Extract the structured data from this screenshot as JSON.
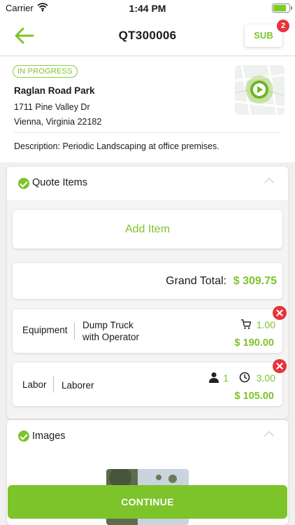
{
  "statusbar": {
    "carrier": "Carrier",
    "time": "1:44 PM"
  },
  "header": {
    "title": "QT300006",
    "sub_label": "SUB",
    "sub_badge": "2"
  },
  "details": {
    "status": "IN PROGRESS",
    "park": "Raglan Road Park",
    "address1": "1711 Pine Valley Dr",
    "address2": "Vienna, Virginia 22182",
    "description": "Description: Periodic Landscaping at office premises."
  },
  "quote_items": {
    "title": "Quote Items",
    "add_item": "Add Item",
    "grand_total_label": "Grand Total:",
    "grand_total_value": "$ 309.75",
    "items": [
      {
        "type": "Equipment",
        "name_line1": "Dump Truck",
        "name_line2": "with Operator",
        "quantity": "1.00",
        "price": "$ 190.00"
      },
      {
        "type": "Labor",
        "name_line1": "Laborer",
        "workers": "1",
        "hours": "3.00",
        "price": "$ 105.00"
      }
    ]
  },
  "images": {
    "title": "Images"
  },
  "footer": {
    "continue_label": "CONTINUE"
  },
  "colors": {
    "accent": "#7dc42a",
    "danger": "#e8333a"
  }
}
